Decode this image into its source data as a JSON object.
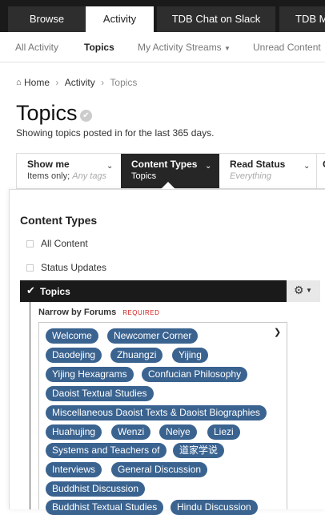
{
  "top_tabs": [
    "Browse",
    "Activity",
    "TDB Chat on Slack",
    "TDB M"
  ],
  "sub_nav": {
    "all_activity": "All Activity",
    "topics": "Topics",
    "streams": "My Activity Streams",
    "unread": "Unread Content"
  },
  "breadcrumb": {
    "home": "Home",
    "activity": "Activity",
    "current": "Topics"
  },
  "page": {
    "title": "Topics",
    "subtitle": "Showing topics posted in for the last 365 days."
  },
  "filters": {
    "show_me": {
      "label": "Show me",
      "value": "Items only;",
      "hint": "Any tags"
    },
    "content_types": {
      "label": "Content Types",
      "value": "Topics"
    },
    "read_status": {
      "label": "Read Status",
      "value": "Everything"
    },
    "overflow": "C"
  },
  "panel": {
    "title": "Content Types",
    "options": [
      "All Content",
      "Status Updates"
    ],
    "selected": "Topics",
    "narrow_label": "Narrow by Forums",
    "required": "REQUIRED",
    "tags": [
      "Welcome",
      "Newcomer Corner",
      "Daodejing",
      "Zhuangzi",
      "Yijing",
      "Yijing Hexagrams",
      "Confucian Philosophy",
      "Daoist Textual Studies",
      "Miscellaneous Daoist Texts & Daoist Biographies",
      "Huahujing",
      "Wenzi",
      "Neiye",
      "Liezi",
      "Systems and Teachers of",
      "道家学说",
      "Interviews",
      "General Discussion",
      "Buddhist Discussion",
      "Buddhist Textual Studies",
      "Hindu Discussion"
    ]
  },
  "colors": {
    "tag": "#3a6390",
    "dark": "#1a1a1a",
    "required": "#d21c1c"
  }
}
